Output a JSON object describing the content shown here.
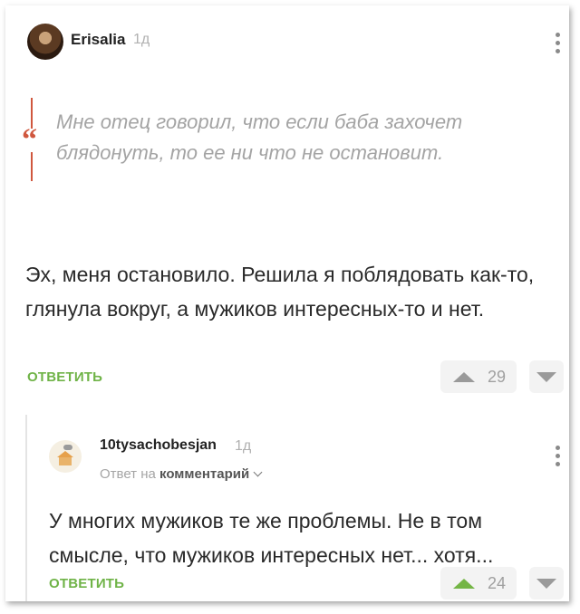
{
  "comment": {
    "author": "Erisalia",
    "time": "1д",
    "quote": "Мне отец говорил, что если баба захочет блядонуть, то ее ни что не остановит.",
    "quote_mark": "“",
    "text": "Эх, меня остановило. Решила я поблядовать как-то, глянула вокруг, а мужиков интересных-то и нет.",
    "reply_label": "ОТВЕТИТЬ",
    "votes": "29"
  },
  "reply": {
    "author": "10tysachobesjan",
    "time": "1д",
    "reply_to_prefix": "Ответ на",
    "reply_to_target": "комментарий",
    "text": "У многих мужиков те же проблемы. Не в том смысле, что мужиков интересных нет... хотя...",
    "reply_label": "ОТВЕТИТЬ",
    "votes": "24"
  },
  "colors": {
    "accent_green": "#6fb347",
    "quote_red": "#d0573e"
  },
  "icons": [
    "more-vertical-icon",
    "upvote-arrow-icon",
    "downvote-arrow-icon",
    "chevron-down-icon"
  ]
}
